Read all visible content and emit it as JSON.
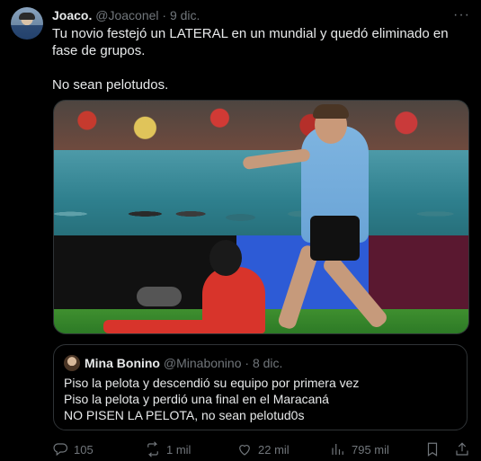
{
  "tweet": {
    "author_name": "Joaco.",
    "handle": "@Joaconel",
    "separator": "·",
    "date": "9 dic.",
    "more_label": "···",
    "text_line1": "Tu novio festejó un LATERAL en un mundial y quedó eliminado en fase de grupos.",
    "text_line2": "No sean pelotudos."
  },
  "media": {
    "description_icon": "photo-soccer-match"
  },
  "quote": {
    "author_name": "Mina Bonino",
    "handle": "@Minabonino",
    "separator": "·",
    "date": "8 dic.",
    "lines": [
      "Piso la pelota y descendió su equipo por primera vez",
      "Piso la pelota y perdió una final en el Maracaná",
      "NO PISEN LA PELOTA, no sean pelotud0s"
    ]
  },
  "actions": {
    "replies": "105",
    "retweets": "1 mil",
    "likes": "22 mil",
    "views": "795 mil",
    "icons": [
      "reply-icon",
      "retweet-icon",
      "like-icon",
      "views-icon",
      "bookmark-icon",
      "share-icon"
    ]
  },
  "colors": {
    "background": "#000000",
    "text": "#e7e9ea",
    "muted": "#71767b",
    "border": "#2f3336"
  }
}
